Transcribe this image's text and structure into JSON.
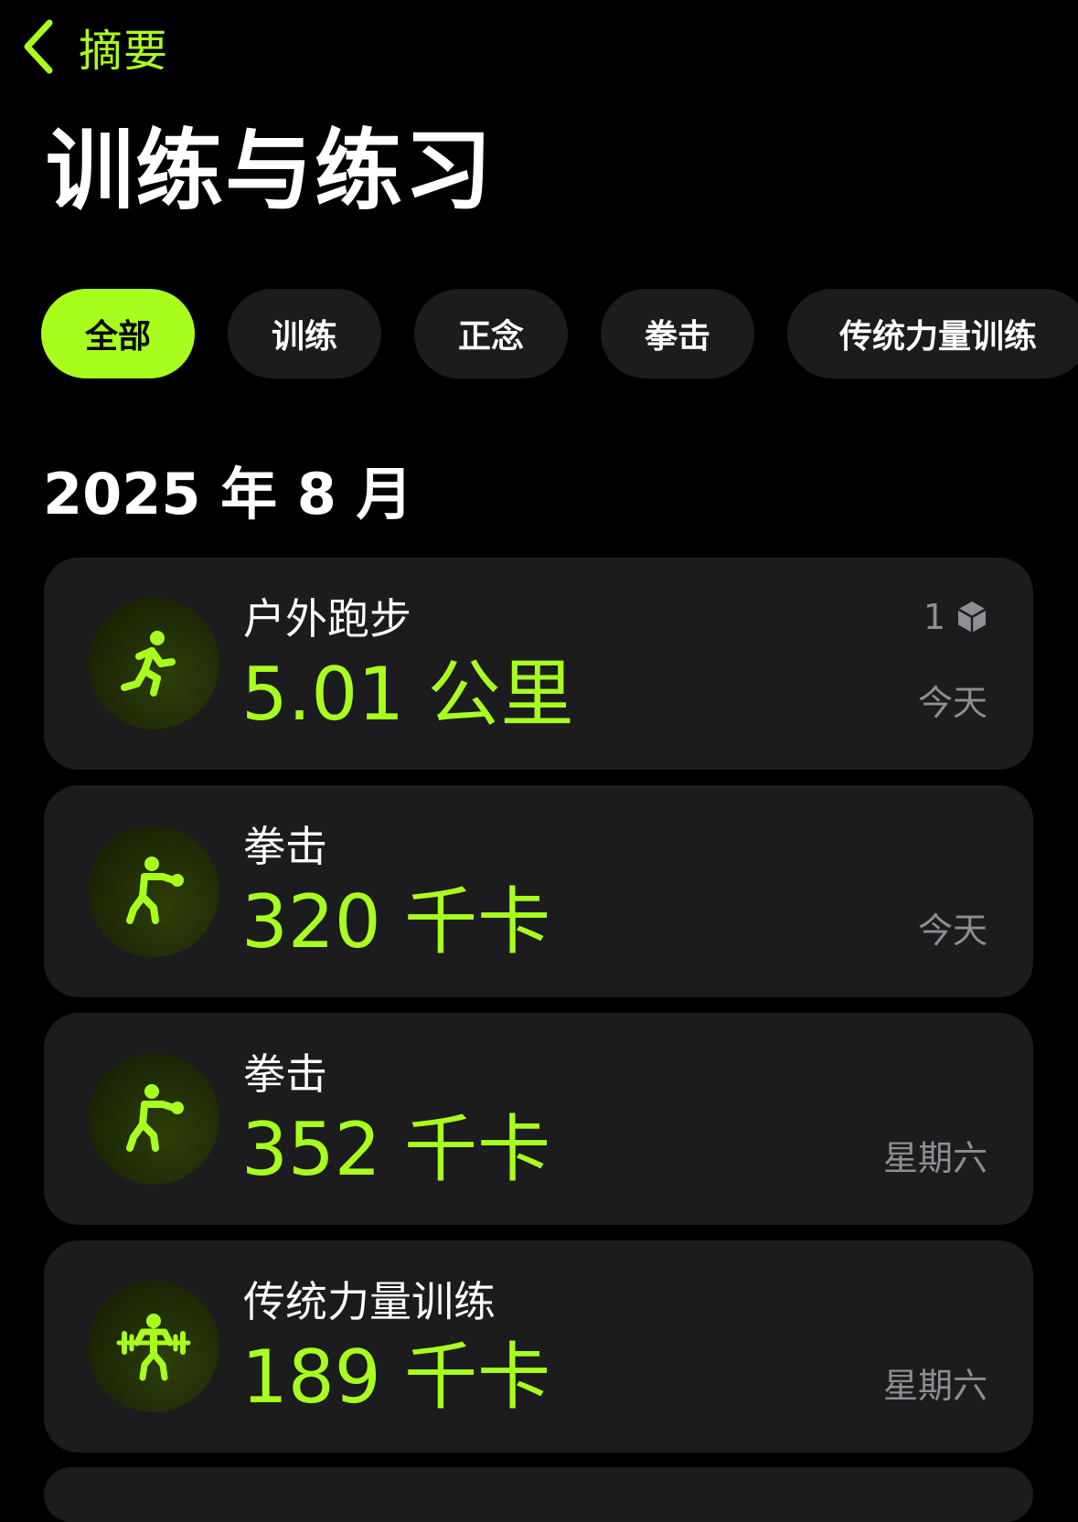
{
  "nav": {
    "back_label": "摘要"
  },
  "page_title": "训练与练习",
  "filters": [
    {
      "label": "全部",
      "active": true
    },
    {
      "label": "训练",
      "active": false
    },
    {
      "label": "正念",
      "active": false
    },
    {
      "label": "拳击",
      "active": false
    },
    {
      "label": "传统力量训练",
      "active": false
    }
  ],
  "section": {
    "heading": "2025 年 8 月"
  },
  "workouts": [
    {
      "icon": "running-figure-icon",
      "title": "户外跑步",
      "value": "5.01 公里",
      "date": "今天",
      "badge_count": "1",
      "badge_icon": "shared-hexagon-icon"
    },
    {
      "icon": "boxing-figure-icon",
      "title": "拳击",
      "value": "320 千卡",
      "date": "今天"
    },
    {
      "icon": "boxing-figure-icon",
      "title": "拳击",
      "value": "352 千卡",
      "date": "星期六"
    },
    {
      "icon": "weightlifting-figure-icon",
      "title": "传统力量训练",
      "value": "189 千卡",
      "date": "星期六"
    }
  ],
  "colors": {
    "accent": "#a8ff1e",
    "card_background": "#1c1c1e",
    "secondary_text": "#8e8e93",
    "background": "#000000"
  }
}
